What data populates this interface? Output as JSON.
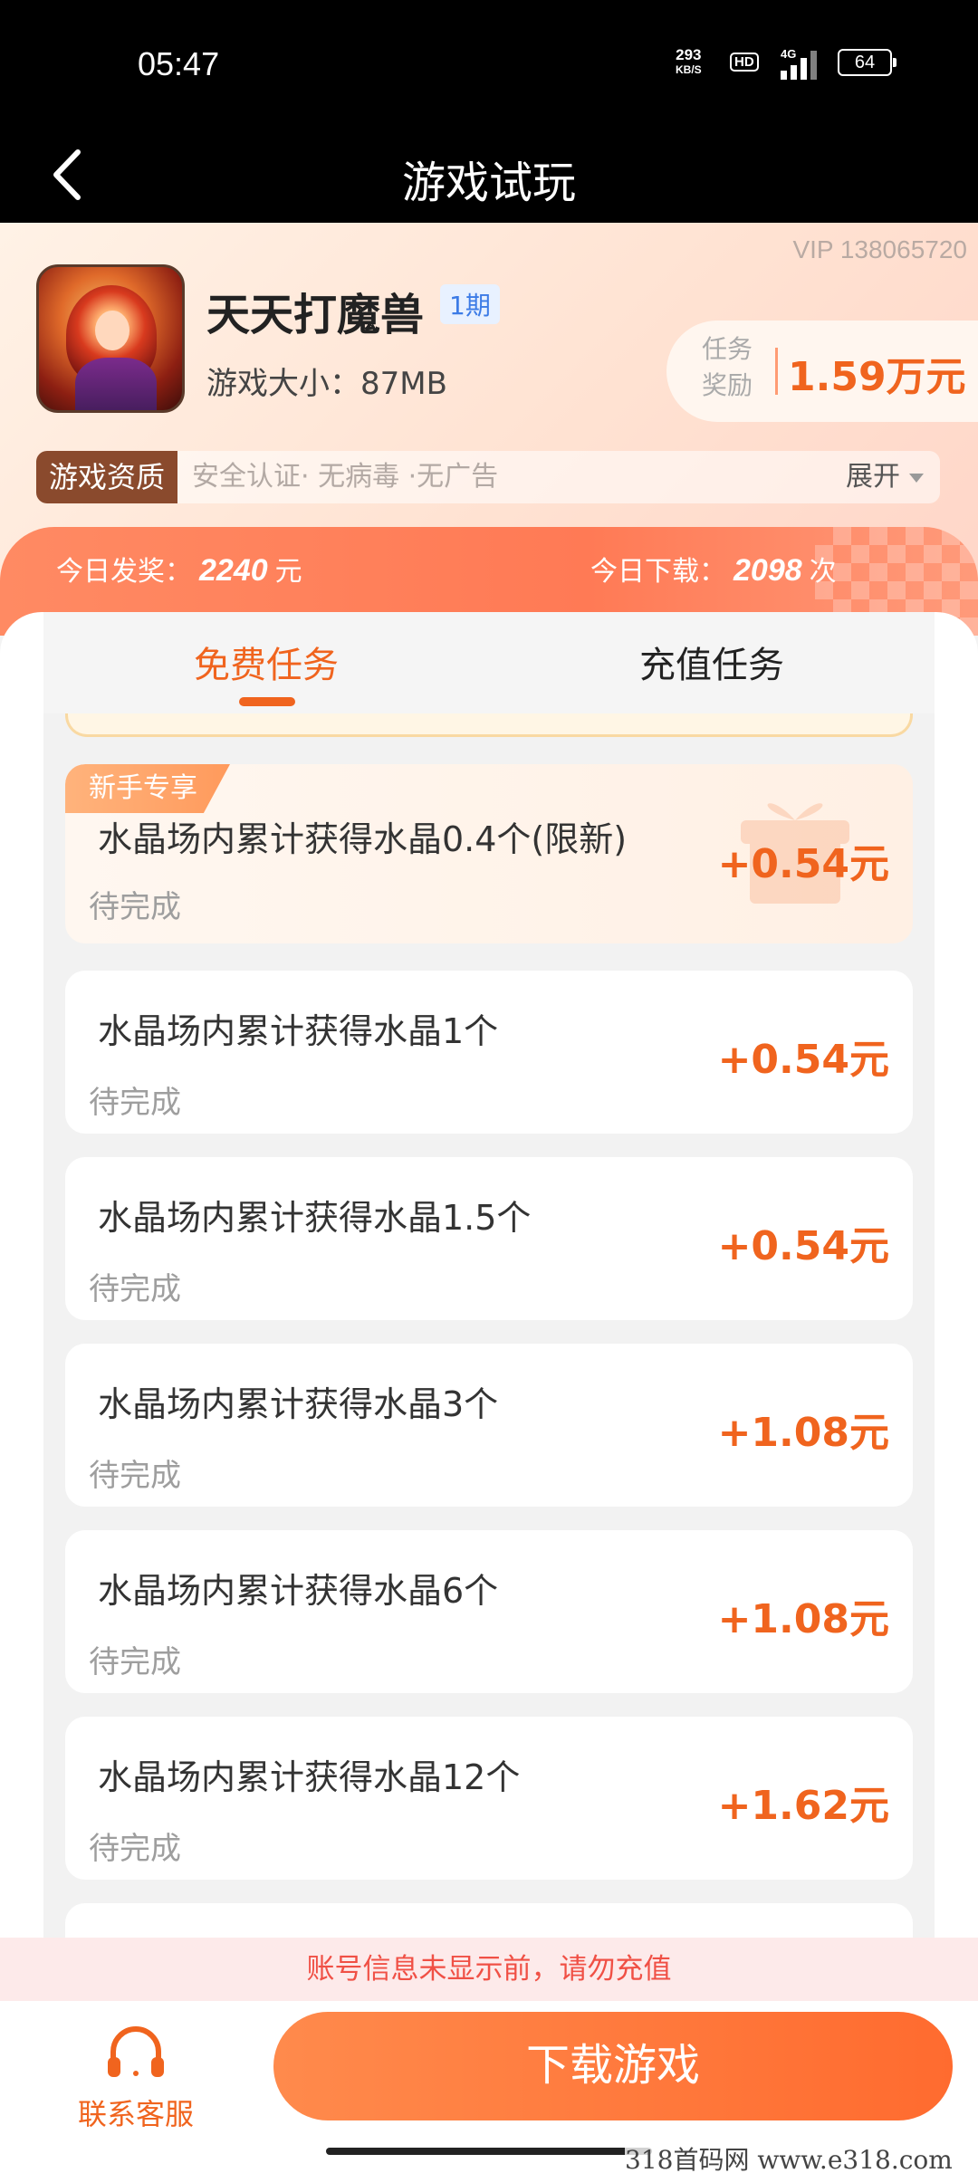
{
  "status_bar": {
    "time": "05:47",
    "net_speed_value": "293",
    "net_speed_unit": "KB/S",
    "hd": "HD",
    "network": "4G",
    "battery": "64"
  },
  "title_bar": {
    "title": "游戏试玩"
  },
  "game": {
    "vip_id": "VIP 138065720",
    "name": "天天打魔兽",
    "period": "1期",
    "size": "游戏大小：87MB",
    "reward_label": "任务奖励",
    "reward_value": "1.59万元",
    "qualification_tag": "游戏资质",
    "qualification_text": "安全认证· 无病毒 ·无广告",
    "expand_label": "展开"
  },
  "stats": {
    "today_award_label": "今日发奖：",
    "today_award_value": "2240",
    "today_award_unit": "元",
    "today_download_label": "今日下载：",
    "today_download_value": "2098",
    "today_download_unit": "次"
  },
  "tabs": [
    {
      "label": "免费任务",
      "active": true
    },
    {
      "label": "充值任务",
      "active": false
    }
  ],
  "tasks": [
    {
      "badge": "新手专享",
      "title": "水晶场内累计获得水晶0.4个(限新)",
      "status": "待完成",
      "reward": "+0.54元"
    },
    {
      "title": "水晶场内累计获得水晶1个",
      "status": "待完成",
      "reward": "+0.54元"
    },
    {
      "title": "水晶场内累计获得水晶1.5个",
      "status": "待完成",
      "reward": "+0.54元"
    },
    {
      "title": "水晶场内累计获得水晶3个",
      "status": "待完成",
      "reward": "+1.08元"
    },
    {
      "title": "水晶场内累计获得水晶6个",
      "status": "待完成",
      "reward": "+1.08元"
    },
    {
      "title": "水晶场内累计获得水晶12个",
      "status": "待完成",
      "reward": "+1.62元"
    }
  ],
  "warning": "账号信息未显示前，请勿充值",
  "bottom": {
    "customer_service": "联系客服",
    "download": "下载游戏"
  },
  "watermark": "318首码网  www.e318.com",
  "colors": {
    "accent": "#f0641e",
    "warning": "#f05045",
    "badge_blue": "#3c7be6"
  }
}
